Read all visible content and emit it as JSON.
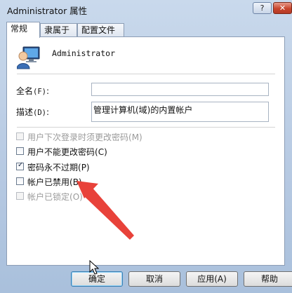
{
  "window": {
    "title": "Administrator 属性",
    "help_label": "?",
    "close_label": "✕"
  },
  "tabs": [
    {
      "label": "常规",
      "active": true
    },
    {
      "label": "隶属于",
      "active": false
    },
    {
      "label": "配置文件",
      "active": false
    }
  ],
  "user": {
    "icon": "user-computer-icon",
    "name": "Administrator"
  },
  "fields": {
    "full_name": {
      "label": "全名",
      "key": "(F)",
      "suffix": ":",
      "value": ""
    },
    "description": {
      "label": "描述",
      "key": "(D)",
      "suffix": ":",
      "value": "管理计算机(域)的内置帐户"
    }
  },
  "checkboxes": [
    {
      "label": "用户下次登录时须更改密码",
      "key": "(M)",
      "checked": false,
      "disabled": true
    },
    {
      "label": "用户不能更改密码",
      "key": "(C)",
      "checked": false,
      "disabled": false
    },
    {
      "label": "密码永不过期",
      "key": "(P)",
      "checked": true,
      "disabled": false
    },
    {
      "label": "帐户已禁用",
      "key": "(B)",
      "checked": false,
      "disabled": false
    },
    {
      "label": "帐户已锁定",
      "key": "(O)",
      "checked": false,
      "disabled": true
    }
  ],
  "buttons": {
    "ok": "确定",
    "cancel": "取消",
    "apply": "应用(A)",
    "help": "帮助"
  },
  "colors": {
    "annotation_arrow": "#e8423a",
    "checkmark": "#1b2a44"
  }
}
